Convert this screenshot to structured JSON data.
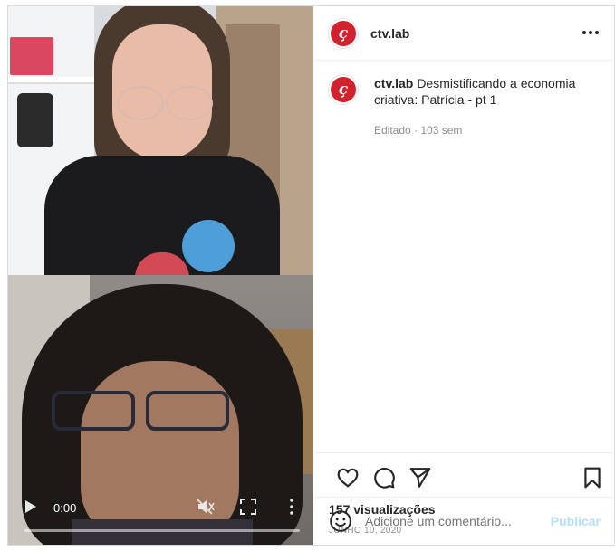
{
  "post": {
    "username": "ctv.lab",
    "avatar_glyph": "ç",
    "caption": "Desmistificando a economia criativa: Patrícia - pt 1",
    "meta": "Editado · 103 sem",
    "views": "157 visualizações",
    "date": "JUNHO 10, 2020"
  },
  "video": {
    "time": "0:00",
    "progress": 0
  },
  "comment": {
    "placeholder": "Adicione um comentário...",
    "post_label": "Publicar"
  },
  "colors": {
    "brand": "#d2222d",
    "post_disabled": "#b2dffc"
  },
  "icons": {
    "like": "heart-icon",
    "comment": "comment-icon",
    "share": "send-icon",
    "save": "bookmark-icon",
    "emoji": "emoji-icon",
    "options": "more-options-icon",
    "play": "play-icon",
    "mute": "muted-icon",
    "fullscreen": "fullscreen-icon",
    "video_more": "vertical-dots-icon"
  }
}
